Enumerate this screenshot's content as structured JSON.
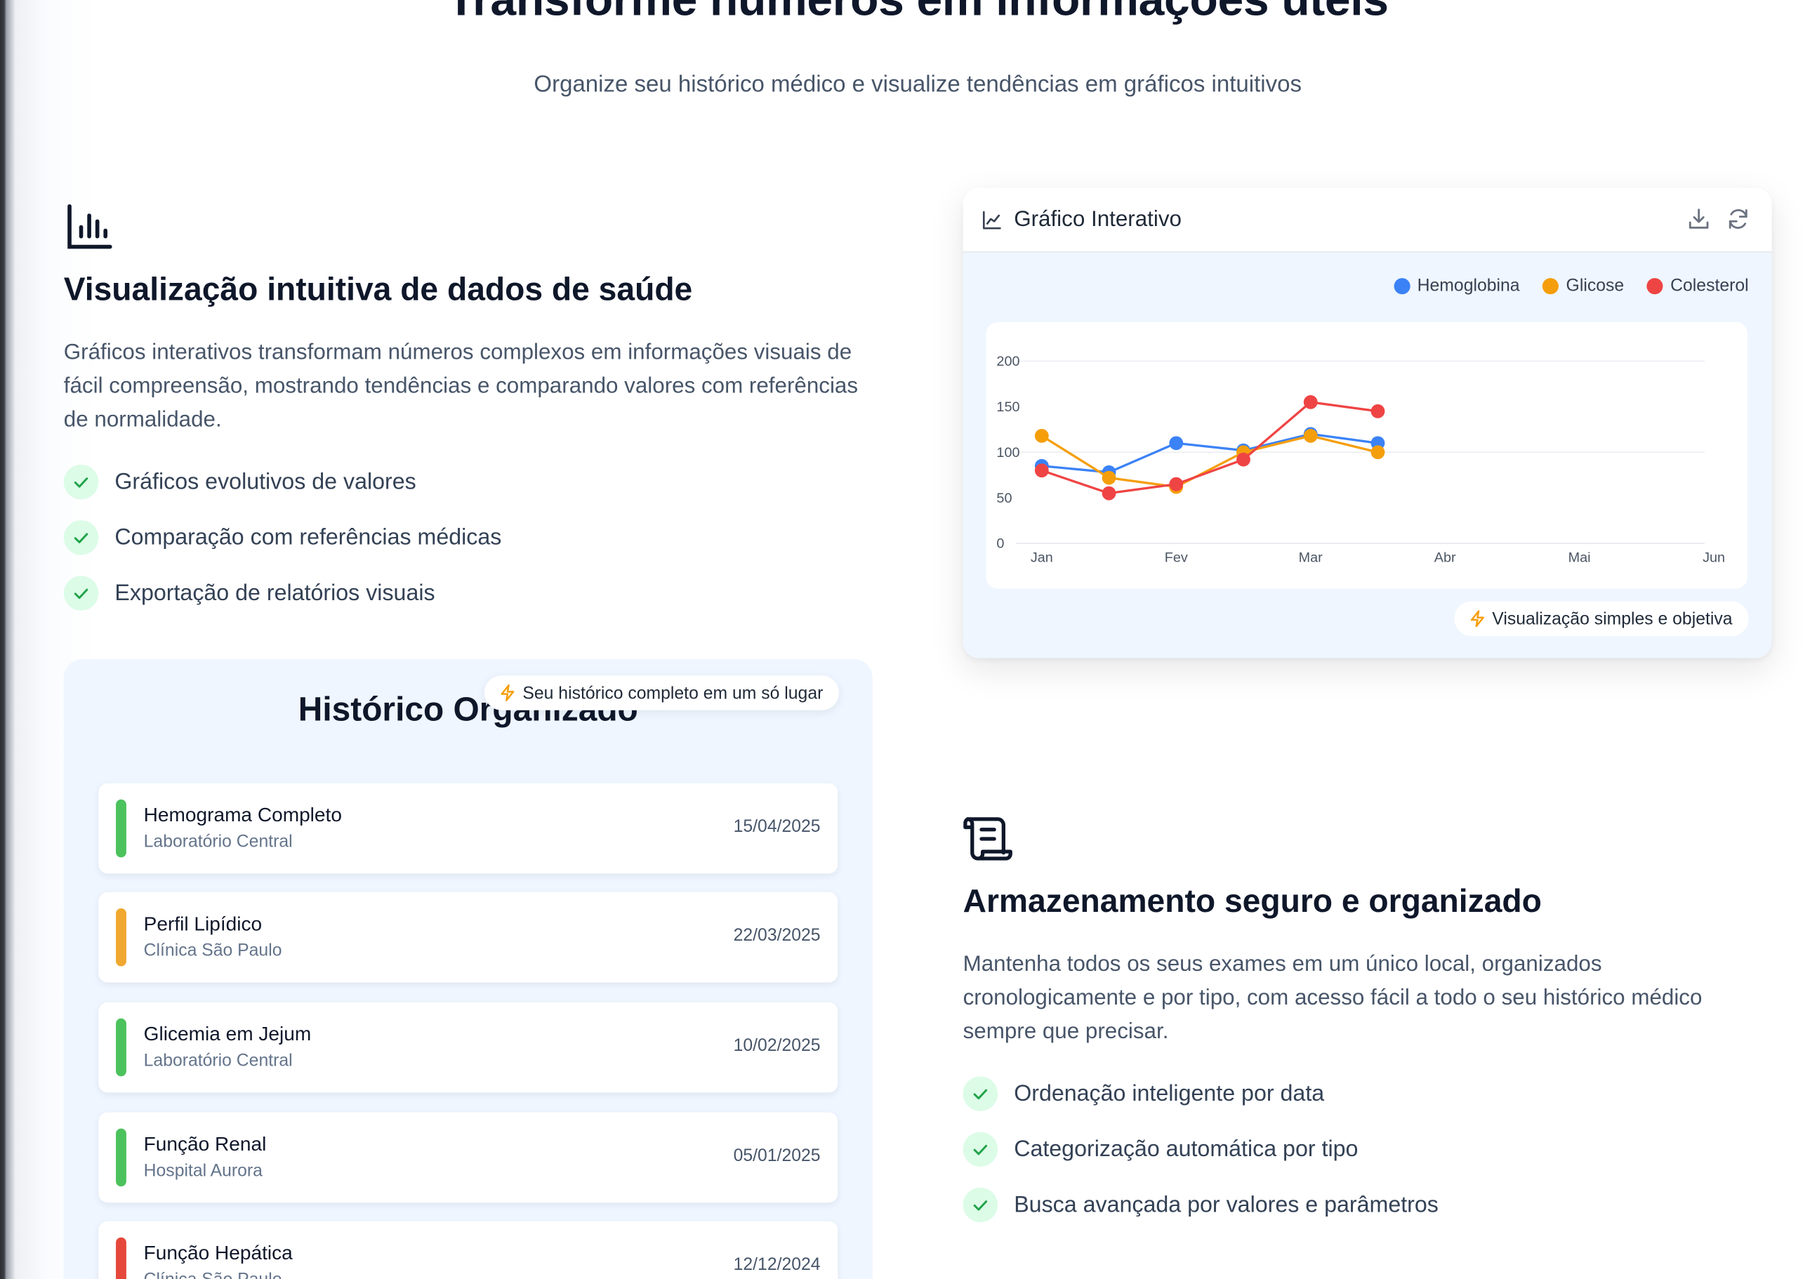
{
  "hero": {
    "title": "Transforme números em informações úteis",
    "subtitle": "Organize seu histórico médico e visualize tendências em gráficos intuitivos"
  },
  "feature_visual": {
    "icon": "bar-chart-icon",
    "title": "Visualização intuitiva de dados de saúde",
    "description": "Gráficos interativos transformam números complexos em informações visuais de fácil compreensão, mostrando tendências e comparando valores com referências de normalidade.",
    "checks": [
      "Gráficos evolutivos de valores",
      "Comparação com referências médicas",
      "Exportação de relatórios visuais"
    ]
  },
  "chart_card": {
    "title": "Gráfico Interativo",
    "badge": "Visualização simples e objetiva",
    "legend": [
      {
        "label": "Hemoglobina",
        "color": "#3b82f6"
      },
      {
        "label": "Glicose",
        "color": "#f59e0b"
      },
      {
        "label": "Colesterol",
        "color": "#ef4444"
      }
    ]
  },
  "chart_data": {
    "type": "line",
    "x": [
      "Jan",
      "Fev",
      "Mar",
      "Abr",
      "Mai",
      "Jun"
    ],
    "yticks": [
      0,
      50,
      100,
      150,
      200
    ],
    "ylim": [
      0,
      225
    ],
    "grid": true,
    "legend_position": "top-right",
    "series": [
      {
        "name": "Hemoglobina",
        "color": "#3b82f6",
        "points": [
          [
            0,
            85
          ],
          [
            0.5,
            78
          ],
          [
            1,
            110
          ],
          [
            1.5,
            102
          ],
          [
            2,
            120
          ],
          [
            2.5,
            110
          ]
        ]
      },
      {
        "name": "Glicose",
        "color": "#f59e0b",
        "points": [
          [
            0,
            118
          ],
          [
            0.5,
            72
          ],
          [
            1,
            62
          ],
          [
            1.5,
            100
          ],
          [
            2,
            118
          ],
          [
            2.5,
            100
          ]
        ]
      },
      {
        "name": "Colesterol",
        "color": "#ef4444",
        "points": [
          [
            0,
            80
          ],
          [
            0.5,
            55
          ],
          [
            1,
            65
          ],
          [
            1.5,
            92
          ],
          [
            2,
            155
          ],
          [
            2.5,
            145
          ]
        ]
      }
    ]
  },
  "history": {
    "title": "Histórico Organizado",
    "badge": "Seu histórico completo em um só lugar",
    "records": [
      {
        "name": "Hemograma Completo",
        "lab": "Laboratório Central",
        "date": "15/04/2025",
        "color": "#4cc25c"
      },
      {
        "name": "Perfil Lipídico",
        "lab": "Clínica São Paulo",
        "date": "22/03/2025",
        "color": "#f0a830"
      },
      {
        "name": "Glicemia em Jejum",
        "lab": "Laboratório Central",
        "date": "10/02/2025",
        "color": "#4cc25c"
      },
      {
        "name": "Função Renal",
        "lab": "Hospital Aurora",
        "date": "05/01/2025",
        "color": "#4cc25c"
      },
      {
        "name": "Função Hepática",
        "lab": "Clínica São Paulo",
        "date": "12/12/2024",
        "color": "#e5483b"
      }
    ]
  },
  "feature_storage": {
    "icon": "scroll-icon",
    "title": "Armazenamento seguro e organizado",
    "description": "Mantenha todos os seus exames em um único local, organizados cronologicamente e por tipo, com acesso fácil a todo o seu histórico médico sempre que precisar.",
    "checks": [
      "Ordenação inteligente por data",
      "Categorização automática por tipo",
      "Busca avançada por valores e parâmetros"
    ]
  }
}
